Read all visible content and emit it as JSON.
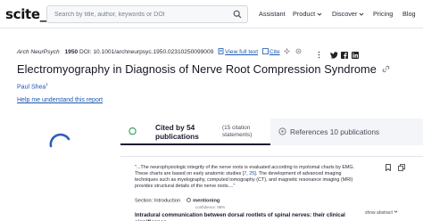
{
  "nav": {
    "logo": "scite_",
    "search_placeholder": "Search by title, author, keywords or DOI",
    "items": [
      "Assistant",
      "Product",
      "Discover",
      "Pricing",
      "Blog"
    ]
  },
  "article": {
    "journal": "Arch NeurPsych",
    "year": "1950",
    "doi": "DOI: 10.1001/archneurpsyc.1950.02310250099009",
    "view_full_text": "View full text",
    "cite": "Cite",
    "title": "Electromyography in Diagnosis of Nerve Root Compression Syndrome",
    "author": "Paul Shea",
    "author_sup": "1",
    "help_link": "Help me understand this report"
  },
  "tabs": {
    "cited_by": "Cited by 54 publications",
    "citation_statements": "(15 citation statements)",
    "references": "References 10 publications"
  },
  "citation_card": {
    "quote_before": "\"...The neurophysiologic integrity of the nerve roots is evaluated according to myotomal charts by EMG. These charts are based on early anatomic studies [",
    "ref_7": "7",
    "ref_sep": ", ",
    "ref_25": "25",
    "quote_after": "]. The development of advanced imaging techniques such as myelography, computed tomography (CT), and magnetic resonance imaging (MRI) provides structural details of the nerve roots....\"",
    "section_label": "Section:",
    "section_value": "Introduction",
    "mentioning": "mentioning",
    "confidence": "confidence: 99%",
    "show_abstract": "show abstract",
    "paper_title": "Intradural communication between dorsal rootlets of spinal nerves: their clinical significance"
  },
  "colors": {
    "link": "#1e56b0",
    "green_icon": "#2e9e5a",
    "spinner": "#2f5fbf"
  }
}
